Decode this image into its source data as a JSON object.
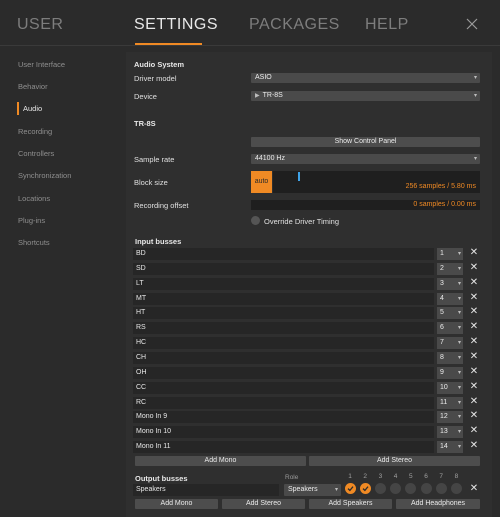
{
  "nav": {
    "tabs": [
      "USER",
      "SETTINGS",
      "PACKAGES",
      "HELP"
    ],
    "active": "SETTINGS",
    "close_icon": "close-icon"
  },
  "sidebar": {
    "items": [
      "User Interface",
      "Behavior",
      "Audio",
      "Recording",
      "Controllers",
      "Synchronization",
      "Locations",
      "Plug-ins",
      "Shortcuts"
    ],
    "active": "Audio"
  },
  "audio_system": {
    "heading": "Audio System",
    "driver_label": "Driver model",
    "driver_value": "ASIO",
    "device_label": "Device",
    "device_value": "TR-8S",
    "device_icon": "play-triangle-icon"
  },
  "device": {
    "heading": "TR-8S",
    "control_panel_label": "Show Control Panel",
    "sample_rate_label": "Sample rate",
    "sample_rate_value": "44100 Hz",
    "block_size_label": "Block size",
    "block_auto_label": "auto",
    "block_size_value": "256 samples / 5.80 ms",
    "recording_offset_label": "Recording offset",
    "recording_offset_value": "0 samples / 0.00 ms",
    "override_label": "Override Driver Timing"
  },
  "input_busses": {
    "heading": "Input busses",
    "rows": [
      {
        "name": "BD",
        "channel": "1"
      },
      {
        "name": "SD",
        "channel": "2"
      },
      {
        "name": "LT",
        "channel": "3"
      },
      {
        "name": "MT",
        "channel": "4"
      },
      {
        "name": "HT",
        "channel": "5"
      },
      {
        "name": "RS",
        "channel": "6"
      },
      {
        "name": "HC",
        "channel": "7"
      },
      {
        "name": "CH",
        "channel": "8"
      },
      {
        "name": "OH",
        "channel": "9"
      },
      {
        "name": "CC",
        "channel": "10"
      },
      {
        "name": "RC",
        "channel": "11"
      },
      {
        "name": "Mono In 9",
        "channel": "12"
      },
      {
        "name": "Mono In 10",
        "channel": "13"
      },
      {
        "name": "Mono In 11",
        "channel": "14"
      }
    ],
    "add_mono_label": "Add Mono",
    "add_stereo_label": "Add Stereo"
  },
  "output_busses": {
    "heading": "Output busses",
    "role_label": "Role",
    "channel_headers": [
      "1",
      "2",
      "3",
      "4",
      "5",
      "6",
      "7",
      "8"
    ],
    "rows": [
      {
        "name": "Speakers",
        "role": "Speakers",
        "active_channels": [
          1,
          2
        ]
      }
    ],
    "buttons": [
      "Add Mono",
      "Add Stereo",
      "Add Speakers",
      "Add Headphones"
    ]
  },
  "colors": {
    "accent": "#f08a24",
    "slider_handle": "#3fa3e8",
    "background": "#2b2b2b"
  }
}
